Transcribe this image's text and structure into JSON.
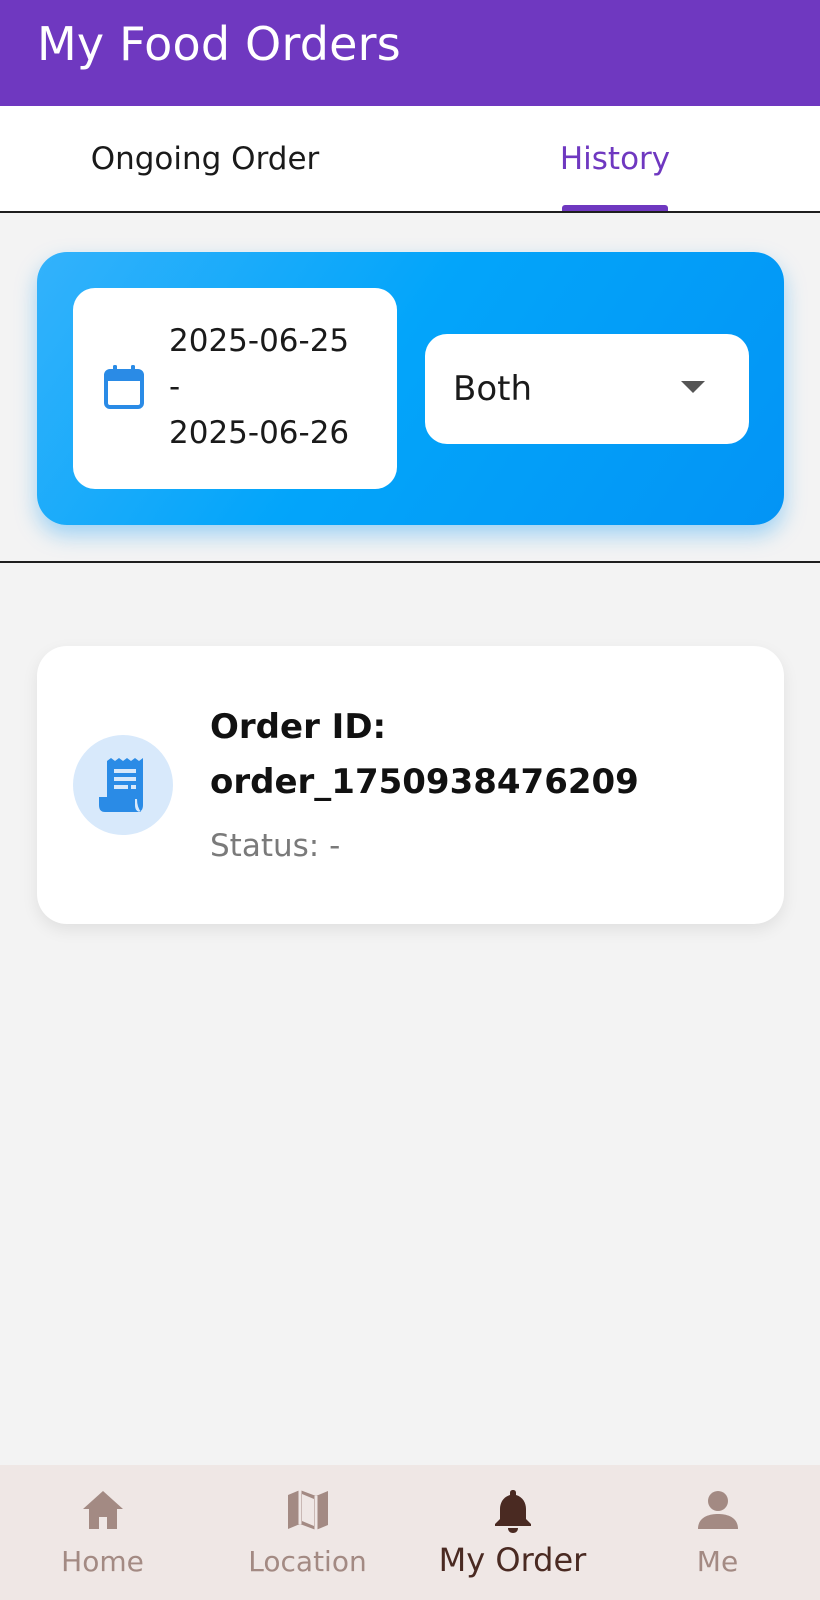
{
  "appbar": {
    "title": "My Food Orders"
  },
  "tabs": [
    {
      "label": "Ongoing Order",
      "active": false
    },
    {
      "label": "History",
      "active": true
    }
  ],
  "filter": {
    "date_start": "2025-06-25",
    "date_separator": "-",
    "date_end": "2025-06-26",
    "type_selected": "Both"
  },
  "orders": [
    {
      "title_prefix": "Order ID:",
      "order_id": "order_1750938476209",
      "status_text": "Status: -"
    }
  ],
  "bottom_nav": [
    {
      "label": "Home",
      "icon": "home-icon",
      "active": false
    },
    {
      "label": "Location",
      "icon": "map-icon",
      "active": false
    },
    {
      "label": "My Order",
      "icon": "bell-icon",
      "active": true
    },
    {
      "label": "Me",
      "icon": "person-icon",
      "active": false
    }
  ],
  "colors": {
    "primary": "#6f38c0",
    "filter_card": "#03a5fa",
    "icon_blue": "#2a8be6",
    "nav_background": "#efe7e5",
    "nav_inactive": "#a38a83",
    "nav_active": "#4a2a22"
  }
}
